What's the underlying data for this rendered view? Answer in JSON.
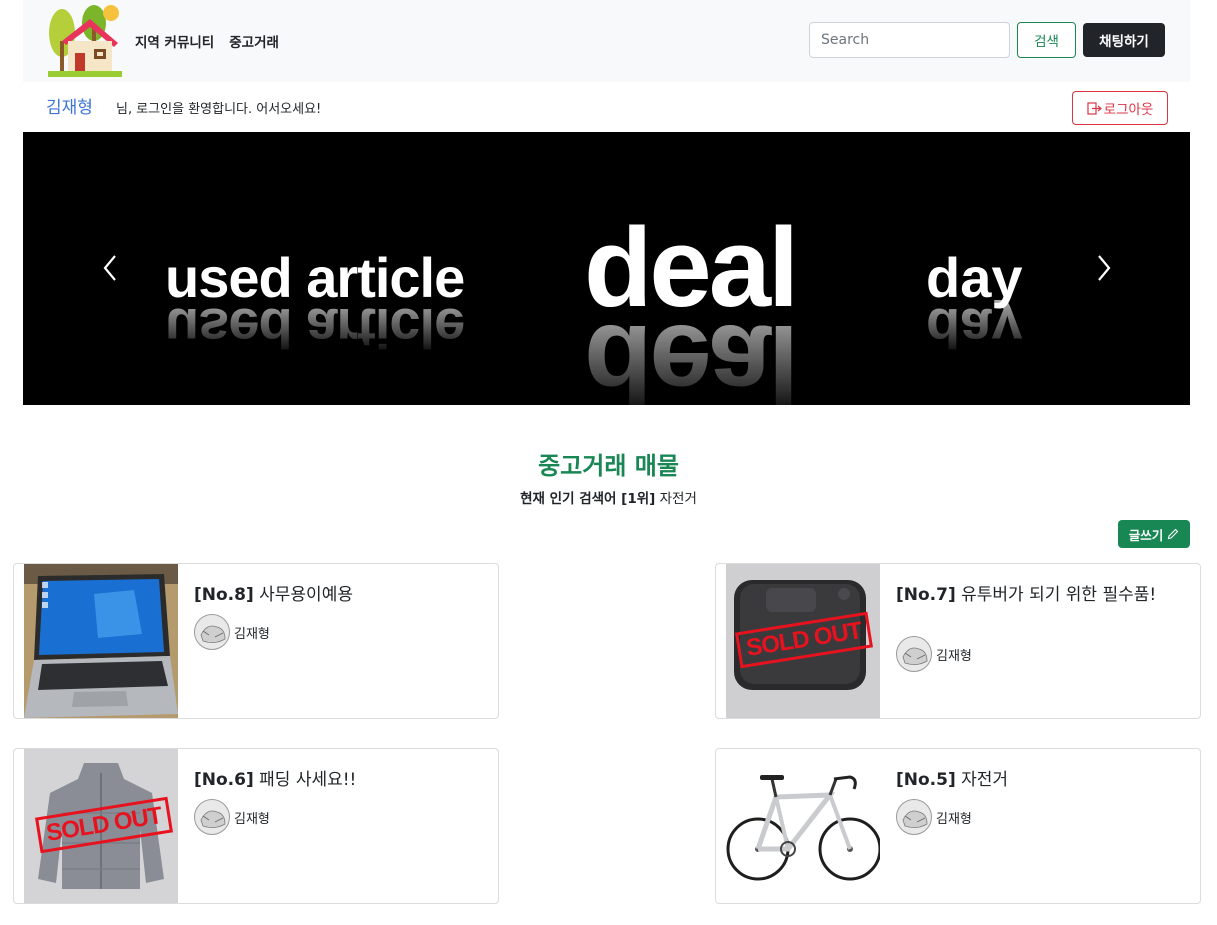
{
  "nav": {
    "links": [
      "지역 커뮤니티",
      "중고거래"
    ],
    "search_placeholder": "Search",
    "search_label": "검색",
    "chat_label": "채팅하기"
  },
  "user": {
    "name": "김재형",
    "welcome": "님, 로그인을 환영합니다. 어서오세요!",
    "logout_label": "로그아웃"
  },
  "banner": {
    "words": [
      "used article",
      "deal",
      "day"
    ]
  },
  "section": {
    "title": "중고거래 매물",
    "trend_prefix": "현재 인기 검색어 [1위]",
    "trend_value": "자전거",
    "write_label": "글쓰기"
  },
  "posts": [
    {
      "no": "[No.8]",
      "title": "사무용이예용",
      "author": "김재형",
      "sold_out": false,
      "image": "laptop"
    },
    {
      "no": "[No.7]",
      "title": "유투버가 되기 위한 필수품!",
      "author": "김재형",
      "sold_out": true,
      "image": "action-camera"
    },
    {
      "no": "[No.6]",
      "title": "패딩 사세요!!",
      "author": "김재형",
      "sold_out": true,
      "image": "padded-jacket"
    },
    {
      "no": "[No.5]",
      "title": "자전거",
      "author": "김재형",
      "sold_out": false,
      "image": "road-bicycle"
    }
  ],
  "sold_out_label": "SOLD OUT",
  "colors": {
    "primary_green": "#198754",
    "danger_red": "#dc3545",
    "username_blue": "#3d74d6",
    "dark": "#212529"
  }
}
